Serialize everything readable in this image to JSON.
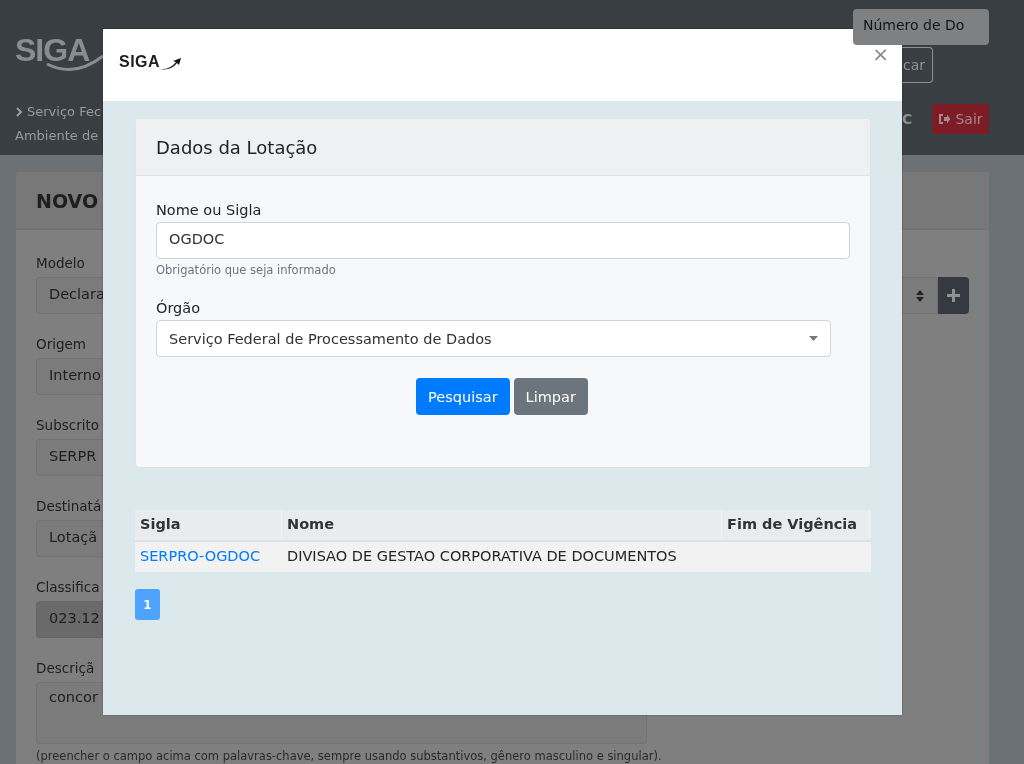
{
  "background": {
    "logo": "SIGA",
    "search": {
      "placeholder": "Número de Do"
    },
    "search_button": "car",
    "breadcrumb": [
      "Serviço Fec",
      "Ambiente de"
    ],
    "user": "C",
    "logout": "Sair",
    "card": {
      "title": "NOVO",
      "fields": [
        {
          "label": "Modelo",
          "value": "Declara",
          "readonly": false
        },
        {
          "label": "Origem",
          "value": "Interno",
          "readonly": false
        },
        {
          "label": "Subscrito",
          "value": "SERPR",
          "readonly": false
        },
        {
          "label": "Destinatá",
          "value": "Lotaçã",
          "readonly": false
        },
        {
          "label": "Classifica",
          "value": "023.12",
          "readonly": true
        }
      ],
      "description": {
        "label": "Descriçã",
        "value": "concor",
        "hint": "(preencher o campo acima com palavras-chave, sempre usando substantivos, gênero masculino e singular)."
      }
    }
  },
  "modal": {
    "logo": "SIGA",
    "close": "×",
    "panel": {
      "title": "Dados da Lotação",
      "name_label": "Nome ou Sigla",
      "name_value": "OGDOC",
      "name_help": "Obrigatório que seja informado",
      "org_label": "Órgão",
      "org_value": "Serviço Federal de Processamento de Dados",
      "buttons": [
        {
          "label": "Pesquisar",
          "kind": "primary"
        },
        {
          "label": "Limpar",
          "kind": "secondary"
        }
      ]
    },
    "table": {
      "columns": [
        "Sigla",
        "Nome",
        "Fim de Vigência"
      ],
      "rows": [
        {
          "sigla": "SERPRO-OGDOC",
          "nome": "DIVISAO DE GESTAO CORPORATIVA DE DOCUMENTOS"
        }
      ]
    },
    "pages": [
      {
        "label": "1",
        "selected": true
      }
    ]
  }
}
